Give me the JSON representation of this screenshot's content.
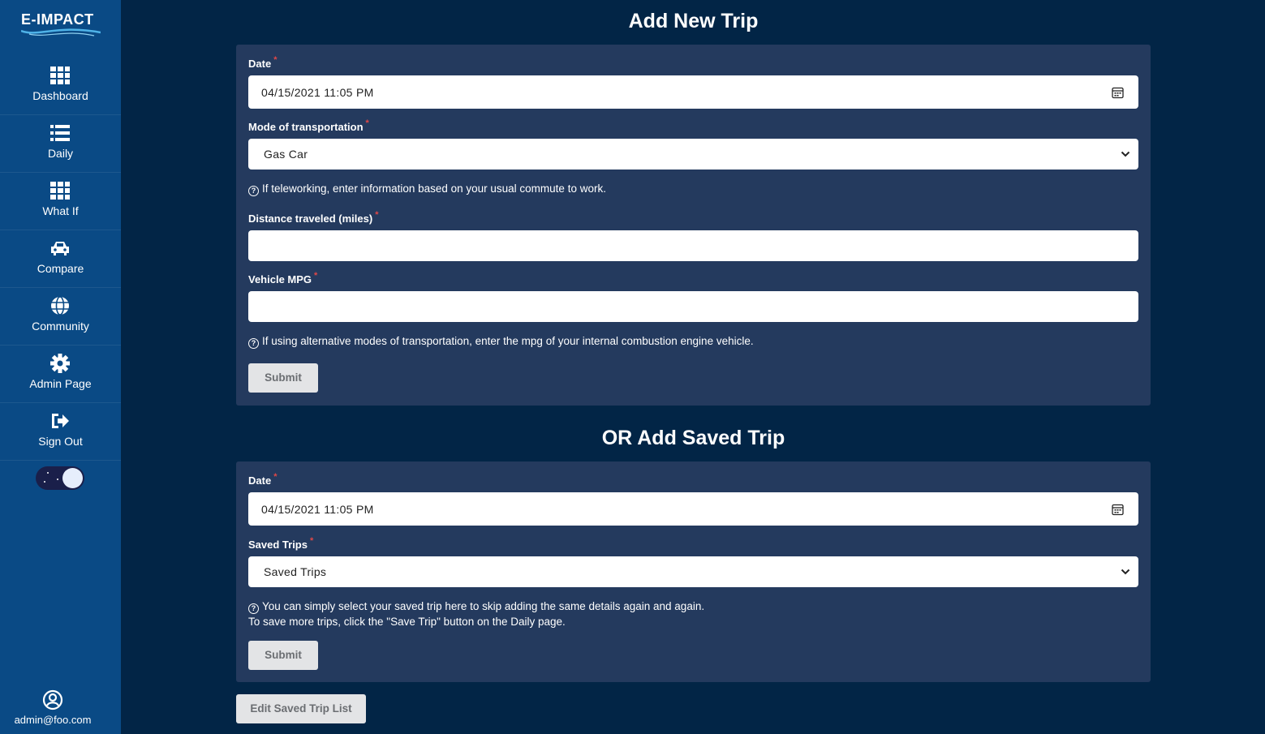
{
  "app": {
    "logo_text": "E-IMPACT"
  },
  "sidebar": {
    "items": [
      {
        "label": "Dashboard",
        "icon": "grid-icon"
      },
      {
        "label": "Daily",
        "icon": "list-icon"
      },
      {
        "label": "What If",
        "icon": "grid-icon"
      },
      {
        "label": "Compare",
        "icon": "car-icon"
      },
      {
        "label": "Community",
        "icon": "globe-icon"
      },
      {
        "label": "Admin Page",
        "icon": "gear-icon"
      },
      {
        "label": "Sign Out",
        "icon": "sign-out-icon"
      }
    ],
    "theme_toggle": "dark-mode-toggle",
    "user_email": "admin@foo.com"
  },
  "new_trip": {
    "title": "Add New Trip",
    "date_label": "Date",
    "date_value": "04/15/2021 11:05 PM",
    "mode_label": "Mode of transportation",
    "mode_value": "Gas Car",
    "telework_hint": "If teleworking, enter information based on your usual commute to work.",
    "distance_label": "Distance traveled (miles)",
    "distance_value": "",
    "mpg_label": "Vehicle MPG",
    "mpg_value": "",
    "mpg_hint": "If using alternative modes of transportation, enter the mpg of your internal combustion engine vehicle.",
    "submit_label": "Submit"
  },
  "saved_trip": {
    "title": "OR Add Saved Trip",
    "date_label": "Date",
    "date_value": "04/15/2021 11:05 PM",
    "saved_label": "Saved Trips",
    "saved_value": "Saved Trips",
    "hint_line1": "You can simply select your saved trip here to skip adding the same details again and again.",
    "hint_line2": "To save more trips, click the \"Save Trip\" button on the Daily page.",
    "submit_label": "Submit"
  },
  "edit_list_label": "Edit Saved Trip List",
  "required_mark": "*"
}
